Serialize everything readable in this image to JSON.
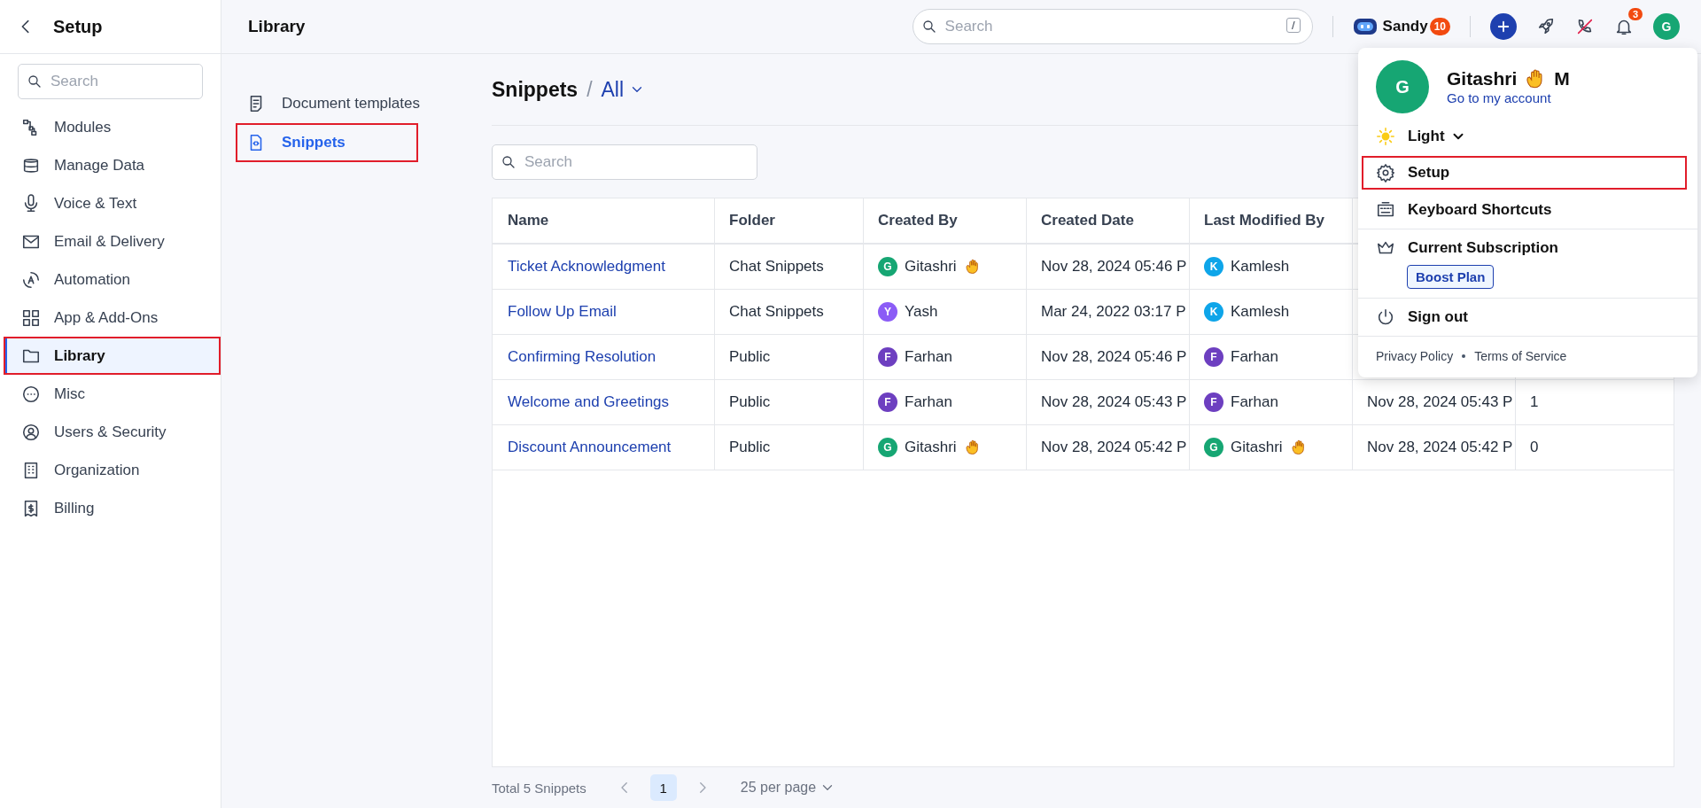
{
  "sidebar": {
    "title": "Setup",
    "search": {
      "placeholder": "Search"
    },
    "items": [
      {
        "label": "Modules",
        "selected": false,
        "highlighted": false
      },
      {
        "label": "Manage Data",
        "selected": false,
        "highlighted": false
      },
      {
        "label": "Voice & Text",
        "selected": false,
        "highlighted": false
      },
      {
        "label": "Email & Delivery",
        "selected": false,
        "highlighted": false
      },
      {
        "label": "Automation",
        "selected": false,
        "highlighted": false
      },
      {
        "label": "App & Add-Ons",
        "selected": false,
        "highlighted": false
      },
      {
        "label": "Library",
        "selected": true,
        "highlighted": true
      },
      {
        "label": "Misc",
        "selected": false,
        "highlighted": false
      },
      {
        "label": "Users & Security",
        "selected": false,
        "highlighted": false
      },
      {
        "label": "Organization",
        "selected": false,
        "highlighted": false
      },
      {
        "label": "Billing",
        "selected": false,
        "highlighted": false
      }
    ]
  },
  "header": {
    "title": "Library",
    "search": {
      "placeholder": "Search",
      "shortcut": "/"
    },
    "agent": {
      "name": "Sandy",
      "badge": "10"
    },
    "notifications": {
      "badge": "3"
    },
    "avatar": "G"
  },
  "subnav": {
    "items": [
      {
        "label": "Document templates",
        "selected": false,
        "highlighted": false
      },
      {
        "label": "Snippets",
        "selected": true,
        "highlighted": true
      }
    ]
  },
  "main": {
    "title": "Snippets",
    "separator": "/",
    "filter": "All",
    "search": {
      "placeholder": "Search"
    },
    "table": {
      "columns": [
        "Name",
        "Folder",
        "Created By",
        "Created Date",
        "Last Modified By"
      ],
      "rows": [
        {
          "name": "Ticket Acknowledgment",
          "folder": "Chat Snippets",
          "created_by": {
            "initial": "G",
            "name": "Gitashri",
            "wave": true,
            "color": "#16a673"
          },
          "created_date": "Nov 28, 2024 05:46 P",
          "modified_by": {
            "initial": "K",
            "name": "Kamlesh",
            "wave": false,
            "color": "#0ea5e9"
          }
        },
        {
          "name": "Follow Up Email",
          "folder": "Chat Snippets",
          "created_by": {
            "initial": "Y",
            "name": "Yash",
            "wave": false,
            "color": "#8b5cf6"
          },
          "created_date": "Mar 24, 2022 03:17 P",
          "modified_by": {
            "initial": "K",
            "name": "Kamlesh",
            "wave": false,
            "color": "#0ea5e9"
          }
        },
        {
          "name": "Confirming Resolution",
          "folder": "Public",
          "created_by": {
            "initial": "F",
            "name": "Farhan",
            "wave": false,
            "color": "#6d3fc0"
          },
          "created_date": "Nov 28, 2024 05:46 P",
          "modified_by": {
            "initial": "F",
            "name": "Farhan",
            "wave": false,
            "color": "#6d3fc0"
          }
        },
        {
          "name": "Welcome and Greetings",
          "folder": "Public",
          "created_by": {
            "initial": "F",
            "name": "Farhan",
            "wave": false,
            "color": "#6d3fc0"
          },
          "created_date": "Nov 28, 2024 05:43 P",
          "modified_by": {
            "initial": "F",
            "name": "Farhan",
            "wave": false,
            "color": "#6d3fc0"
          },
          "column_6": "Nov 28, 2024 05:43 P",
          "column_7": "1"
        },
        {
          "name": "Discount Announcement",
          "folder": "Public",
          "created_by": {
            "initial": "G",
            "name": "Gitashri",
            "wave": true,
            "color": "#16a673"
          },
          "created_date": "Nov 28, 2024 05:42 P",
          "modified_by": {
            "initial": "G",
            "name": "Gitashri",
            "wave": true,
            "color": "#16a673"
          },
          "column_6": "Nov 28, 2024 05:42 P",
          "column_7": "0"
        }
      ]
    },
    "footer": {
      "total": "Total 5 Snippets",
      "page": "1",
      "per_page": "25 per page"
    }
  },
  "account_menu": {
    "avatar": "G",
    "first_name": "Gitashri",
    "wave": true,
    "last_name": "M",
    "link": "Go to my account",
    "theme": "Light",
    "items": [
      {
        "label": "Setup",
        "highlighted": true
      },
      {
        "label": "Keyboard Shortcuts",
        "highlighted": false
      },
      {
        "label": "Current Subscription",
        "highlighted": false,
        "plan": "Boost Plan"
      },
      {
        "label": "Sign out",
        "highlighted": false
      }
    ],
    "links": [
      "Privacy Policy",
      "Terms of Service"
    ]
  }
}
